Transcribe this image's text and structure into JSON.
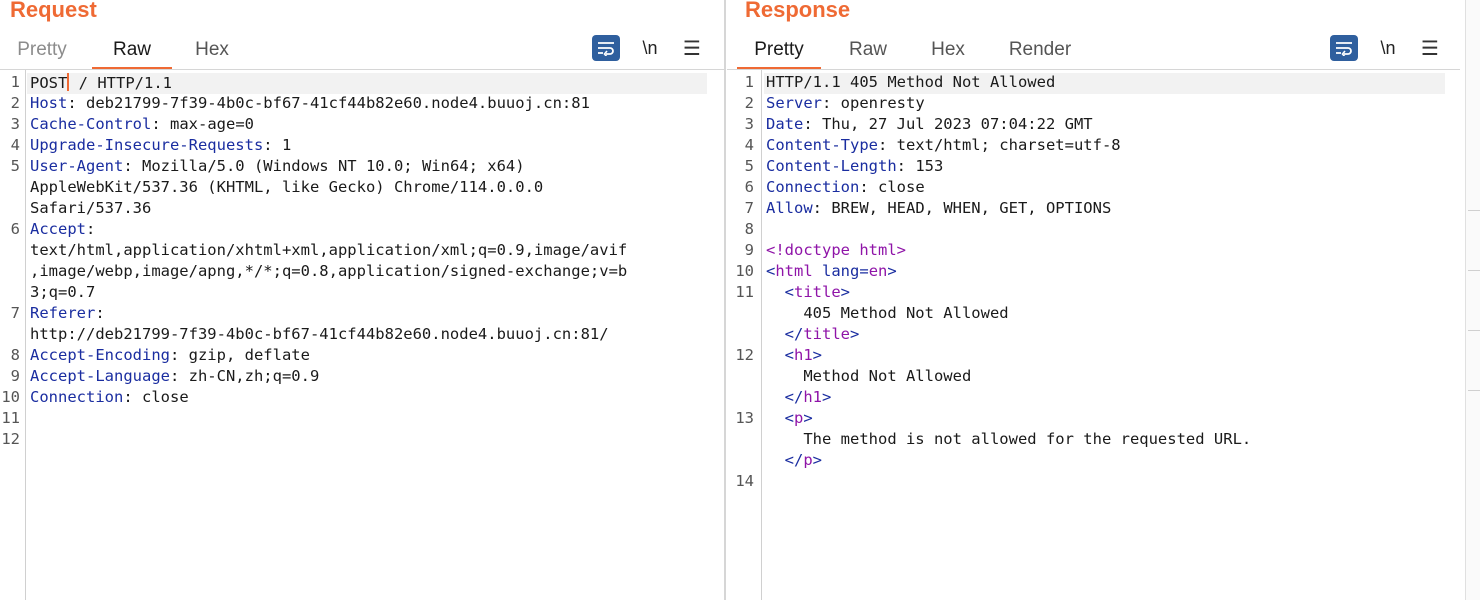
{
  "request": {
    "title": "Request",
    "tabs": [
      "Pretty",
      "Raw",
      "Hex"
    ],
    "active_tab": "Raw",
    "newline_toggle": "\\n",
    "line_numbers": [
      "1",
      "2",
      "3",
      "4",
      "5",
      "",
      "",
      "6",
      "",
      "",
      "",
      "7",
      "",
      "8",
      "9",
      "10",
      "11",
      "12"
    ],
    "lines": [
      {
        "key": "POST",
        "rest": " / HTTP/1.1"
      },
      {
        "key": "Host",
        "rest": ": deb21799-7f39-4b0c-bf67-41cf44b82e60.node4.buuoj.cn:81"
      },
      {
        "key": "Cache-Control",
        "rest": ": max-age=0"
      },
      {
        "key": "Upgrade-Insecure-Requests",
        "rest": ": 1"
      },
      {
        "key": "User-Agent",
        "rest": ": Mozilla/5.0 (Windows NT 10.0; Win64; x64)"
      },
      {
        "key": "",
        "rest": "AppleWebKit/537.36 (KHTML, like Gecko) Chrome/114.0.0.0"
      },
      {
        "key": "",
        "rest": "Safari/537.36"
      },
      {
        "key": "Accept",
        "rest": ":"
      },
      {
        "key": "",
        "rest": "text/html,application/xhtml+xml,application/xml;q=0.9,image/avif"
      },
      {
        "key": "",
        "rest": ",image/webp,image/apng,*/*;q=0.8,application/signed-exchange;v=b"
      },
      {
        "key": "",
        "rest": "3;q=0.7"
      },
      {
        "key": "Referer",
        "rest": ":"
      },
      {
        "key": "",
        "rest": "http://deb21799-7f39-4b0c-bf67-41cf44b82e60.node4.buuoj.cn:81/"
      },
      {
        "key": "Accept-Encoding",
        "rest": ": gzip, deflate"
      },
      {
        "key": "Accept-Language",
        "rest": ": zh-CN,zh;q=0.9"
      },
      {
        "key": "Connection",
        "rest": ": close"
      },
      {
        "key": "",
        "rest": ""
      },
      {
        "key": "",
        "rest": ""
      }
    ]
  },
  "response": {
    "title": "Response",
    "tabs": [
      "Pretty",
      "Raw",
      "Hex",
      "Render"
    ],
    "active_tab": "Pretty",
    "newline_toggle": "\\n",
    "line_numbers": [
      "1",
      "2",
      "3",
      "4",
      "5",
      "6",
      "7",
      "8",
      "9",
      "10",
      "11",
      "",
      "",
      "12",
      "",
      "",
      "13",
      "",
      "",
      "14"
    ],
    "lines": [
      {
        "segs": [
          {
            "t": "HTTP/1.1 405 Method Not Allowed",
            "c": ""
          }
        ]
      },
      {
        "segs": [
          {
            "t": "Server",
            "c": "k"
          },
          {
            "t": ": openresty",
            "c": ""
          }
        ]
      },
      {
        "segs": [
          {
            "t": "Date",
            "c": "k"
          },
          {
            "t": ": Thu, 27 Jul 2023 07:04:22 GMT",
            "c": ""
          }
        ]
      },
      {
        "segs": [
          {
            "t": "Content-Type",
            "c": "k"
          },
          {
            "t": ": text/html; charset=utf-8",
            "c": ""
          }
        ]
      },
      {
        "segs": [
          {
            "t": "Content-Length",
            "c": "k"
          },
          {
            "t": ": 153",
            "c": ""
          }
        ]
      },
      {
        "segs": [
          {
            "t": "Connection",
            "c": "k"
          },
          {
            "t": ": close",
            "c": ""
          }
        ]
      },
      {
        "segs": [
          {
            "t": "Allow",
            "c": "k"
          },
          {
            "t": ": BREW, HEAD, WHEN, GET, OPTIONS",
            "c": ""
          }
        ]
      },
      {
        "segs": []
      },
      {
        "segs": [
          {
            "t": "<!doctype html>",
            "c": "tag"
          }
        ]
      },
      {
        "segs": [
          {
            "t": "<",
            "c": "k"
          },
          {
            "t": "html",
            "c": "tag"
          },
          {
            "t": " lang",
            "c": "k"
          },
          {
            "t": "=",
            "c": "k"
          },
          {
            "t": "en",
            "c": "tag"
          },
          {
            "t": ">",
            "c": "k"
          }
        ]
      },
      {
        "segs": [
          {
            "t": "  <",
            "c": "k"
          },
          {
            "t": "title",
            "c": "tag"
          },
          {
            "t": ">",
            "c": "k"
          }
        ]
      },
      {
        "segs": [
          {
            "t": "    405 Method Not Allowed",
            "c": ""
          }
        ]
      },
      {
        "segs": [
          {
            "t": "  </",
            "c": "k"
          },
          {
            "t": "title",
            "c": "tag"
          },
          {
            "t": ">",
            "c": "k"
          }
        ]
      },
      {
        "segs": [
          {
            "t": "  <",
            "c": "k"
          },
          {
            "t": "h1",
            "c": "tag"
          },
          {
            "t": ">",
            "c": "k"
          }
        ]
      },
      {
        "segs": [
          {
            "t": "    Method Not Allowed",
            "c": ""
          }
        ]
      },
      {
        "segs": [
          {
            "t": "  </",
            "c": "k"
          },
          {
            "t": "h1",
            "c": "tag"
          },
          {
            "t": ">",
            "c": "k"
          }
        ]
      },
      {
        "segs": [
          {
            "t": "  <",
            "c": "k"
          },
          {
            "t": "p",
            "c": "tag"
          },
          {
            "t": ">",
            "c": "k"
          }
        ]
      },
      {
        "segs": [
          {
            "t": "    The method is not allowed for the requested URL.",
            "c": ""
          }
        ]
      },
      {
        "segs": [
          {
            "t": "  </",
            "c": "k"
          },
          {
            "t": "p",
            "c": "tag"
          },
          {
            "t": ">",
            "c": "k"
          }
        ]
      },
      {
        "segs": []
      }
    ]
  },
  "colors": {
    "accent": "#ef6a34",
    "header_key": "#1a2da0",
    "html_tag": "#8f14a8",
    "button_blue": "#2f5f9e"
  },
  "icons": {
    "wrap": "wrap-lines-icon",
    "menu": "hamburger-menu-icon"
  }
}
